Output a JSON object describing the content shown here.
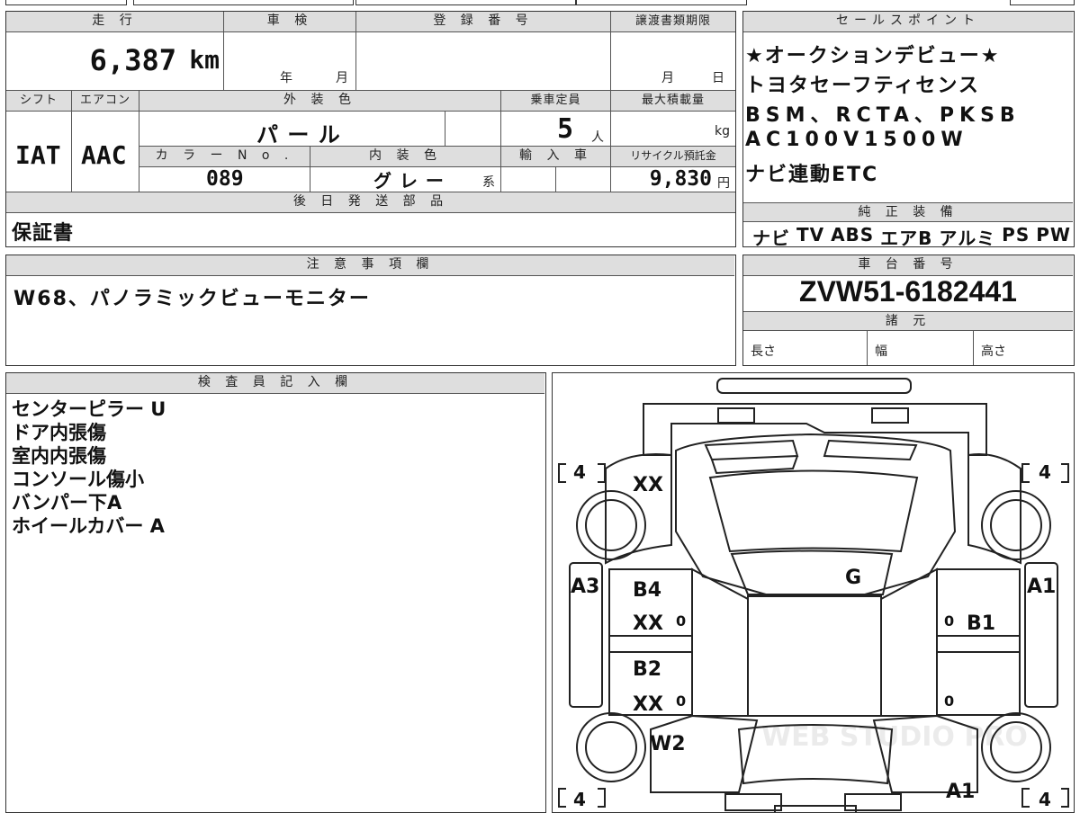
{
  "top_left": {
    "headers": {
      "mileage": "走 行",
      "inspection": "車 検",
      "registration": "登 録 番 号",
      "transfer_deadline": "譲渡書類期限",
      "shift": "シフト",
      "aircon": "エアコン",
      "exterior_color": "外 装 色",
      "capacity": "乗車定員",
      "max_load": "最大積載量",
      "color_no": "カ ラ ー N o .",
      "interior_color": "内 装 色",
      "import": "輸 入 車",
      "recycle": "リサイクル預託金",
      "later_parts": "後 日 発 送 部 品"
    },
    "mileage_value": "6,387",
    "mileage_unit": "km",
    "inspection_year": "年",
    "inspection_month": "月",
    "deadline_month": "月",
    "deadline_day": "日",
    "shift_value": "IAT",
    "aircon_value": "AAC",
    "exterior_color_value": "パ ー ル",
    "capacity_value": "5",
    "capacity_unit": "人",
    "max_load_unit": "kg",
    "color_no_value": "089",
    "interior_color_value": "グ レ ー",
    "interior_color_suffix": "系",
    "recycle_value": "9,830",
    "recycle_unit": "円",
    "later_parts_value": "保証書"
  },
  "sales_points": {
    "header": "セールスポイント",
    "lines": [
      "★オークションデビュー★",
      "トヨタセーフティセンス",
      "BSM、RCTA、PKSB",
      "AC100V1500W",
      "ナビ連動ETC"
    ]
  },
  "genuine_equipment": {
    "header": "純 正 装 備",
    "items": [
      "ナビ",
      "TV",
      "ABS",
      "エアB",
      "アルミ",
      "PS",
      "PW"
    ]
  },
  "caution": {
    "header": "注 意 事 項 欄",
    "text": "W68、パノラミックビューモニター"
  },
  "chassis": {
    "header": "車 台 番 号",
    "number": "ZVW51-6182441",
    "specs_header": "諸 元",
    "length_label": "長さ",
    "width_label": "幅",
    "height_label": "高さ"
  },
  "inspector": {
    "header": "検 査 員 記 入 欄",
    "notes": [
      "センターピラー U",
      "ドア内張傷",
      "室内内張傷",
      "コンソール傷小",
      "バンパー下A",
      "ホイールカバー A"
    ]
  },
  "diagram": {
    "tires": [
      "4",
      "4",
      "4",
      "4"
    ],
    "marks": {
      "front_left": "XX",
      "windshield": "G",
      "left_fender": "A3",
      "right_fender": "A1",
      "left_front_door": "B4",
      "left_front_door_2": "XX",
      "left_rear_door": "B2",
      "left_rear_door_2": "XX",
      "right_front_door": "B1",
      "left_quarter": "W2",
      "right_quarter": "A1"
    },
    "zeros": [
      "0",
      "0",
      "0",
      "0"
    ],
    "watermark": "WEB STUDIO PRO"
  }
}
